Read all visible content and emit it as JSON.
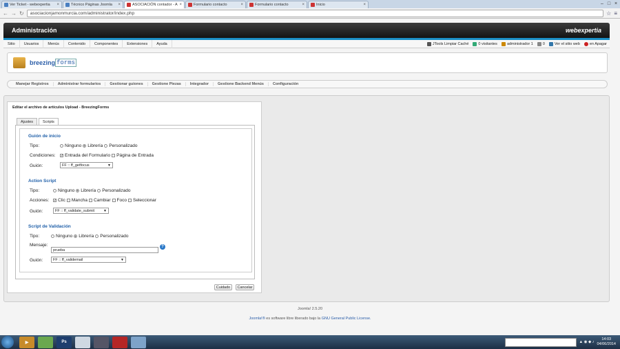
{
  "browser": {
    "tabs": [
      {
        "label": "Ver Ticket - webexpertia",
        "active": false,
        "icon": "page-icon"
      },
      {
        "label": "Técnico Páginas Joomla",
        "active": false,
        "icon": "page-icon"
      },
      {
        "label": "ASOCIACIÓN contador - A",
        "active": true,
        "icon": "joomla-icon"
      },
      {
        "label": "Formulario contacto",
        "active": false,
        "icon": "joomla-icon"
      },
      {
        "label": "Formulario contacto",
        "active": false,
        "icon": "joomla-icon"
      },
      {
        "label": "Inicio",
        "active": false,
        "icon": "joomla-icon"
      }
    ],
    "url": "asociacionjamonmurcia.com/administrator/index.php"
  },
  "header": {
    "title": "Administración",
    "logo": "webexpertia"
  },
  "menu": {
    "items": [
      "Sitio",
      "Usuarios",
      "Menús",
      "Contenido",
      "Componentes",
      "Extensiones",
      "Ayuda"
    ],
    "status": {
      "jtools": "JTools Limpiar Caché",
      "visitors": "0 visitantes",
      "admin": "administrador 1",
      "messages": "0",
      "view_site": "Ver el sitio web",
      "logout": "en Apagar"
    }
  },
  "component": {
    "logo_a": "breezing",
    "logo_b": "forms"
  },
  "subnav": {
    "items": [
      "Manejar Registros",
      "Administrar formularios",
      "Gestionar guiones",
      "Gestione Piezas",
      "Integrador",
      "Gestione Backend Menús",
      "Configuración"
    ]
  },
  "editor": {
    "title": "Editar el archivo de artículos Upload - BreezingForms",
    "tabs": [
      "Ajustes",
      "Scripts"
    ],
    "init": {
      "heading": "Guión de inicio",
      "tipo_label": "Tipo:",
      "tipo_options": [
        "Ninguno",
        "Librería",
        "Personalizado"
      ],
      "cond_label": "Condiciones:",
      "cond_options": [
        "Entrada del Formulario",
        "Página de Entrada"
      ],
      "guion_label": "Guión:",
      "guion_value": "FF :: ff_getfocus"
    },
    "action": {
      "heading": "Action Script",
      "tipo_label": "Tipo:",
      "tipo_options": [
        "Ninguno",
        "Librería",
        "Personalizado"
      ],
      "acc_label": "Acciones:",
      "acc_options": [
        "Clic",
        "Mancha",
        "Cambiar",
        "Foco",
        "Seleccionar"
      ],
      "guion_label": "Guión:",
      "guion_value": "FF :: ff_validate_submit"
    },
    "validation": {
      "heading": "Script de Validación",
      "tipo_label": "Tipo:",
      "tipo_options": [
        "Ninguno",
        "Librería",
        "Personalizado"
      ],
      "msg_label": "Mensaje:",
      "msg_value": "prueba",
      "guion_label": "Guión:",
      "guion_value": "FF :: ff_validemail"
    },
    "save": "Cuidado",
    "cancel": "Cancelar"
  },
  "footer": {
    "version": "Joomla! 2.5.20",
    "license_prefix": "Joomla!®",
    "license_mid": " es software libre liberado bajo la ",
    "license_link": "GNU General Public License."
  },
  "taskbar": {
    "time": "14:03",
    "date": "04/06/2014"
  }
}
